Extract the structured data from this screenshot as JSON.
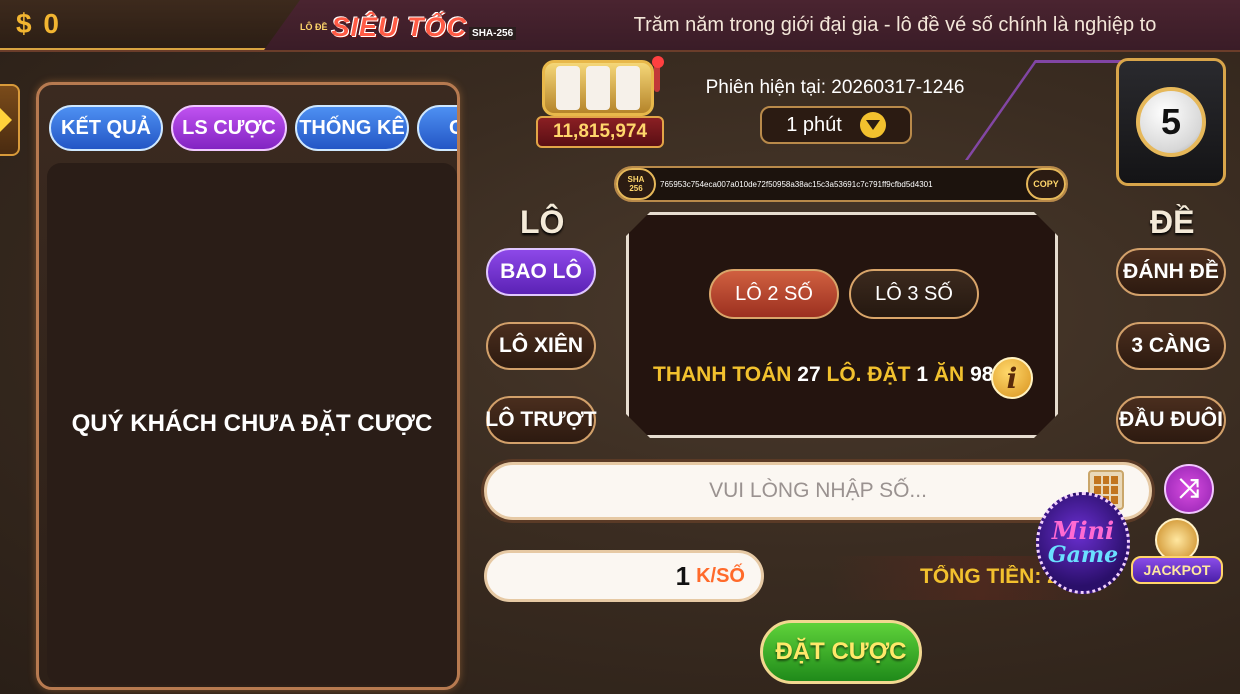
{
  "header": {
    "balance": "$ 0",
    "logo_small": "LÔ ĐỀ",
    "logo_main": "SIÊU TỐC",
    "logo_sub": "SHA-256",
    "slogan": "Trăm năm trong giới đại gia - lô đề vé số chính là nghiệp to"
  },
  "left_panel": {
    "tabs": [
      {
        "label": "KẾT QUẢ"
      },
      {
        "label": "LS CƯỢC"
      },
      {
        "label": "THỐNG KÊ"
      },
      {
        "label": "C"
      }
    ],
    "empty_message": "QUÝ KHÁCH CHƯA ĐẶT CƯỢC"
  },
  "round": {
    "jackpot_amount": "11,815,974",
    "session_label": "Phiên hiện tại: 20260317-1246",
    "timer_value": "1 phút",
    "drawn_ball": "5"
  },
  "hash": {
    "tag_line1": "SHA",
    "tag_line2": "256",
    "value": "765953c754eca007a010de72f50958a38ac15c3a53691c7c791ff9cfbd5d4301",
    "copy_label": "COPY"
  },
  "lo_section": {
    "title": "LÔ",
    "buttons": [
      {
        "label": "BAO LÔ",
        "active": true
      },
      {
        "label": "LÔ XIÊN",
        "active": false
      },
      {
        "label": "LÔ TRƯỢT",
        "active": false
      }
    ]
  },
  "de_section": {
    "title": "ĐỀ",
    "buttons": [
      {
        "label": "ĐÁNH ĐỀ"
      },
      {
        "label": "3 CÀNG"
      },
      {
        "label": "ĐẦU ĐUÔI"
      }
    ]
  },
  "bet_type": {
    "options": [
      {
        "label": "LÔ 2 SỐ",
        "selected": true
      },
      {
        "label": "LÔ 3 SỐ",
        "selected": false
      }
    ],
    "payout_prefix": "THANH TOÁN",
    "payout_pay": "27",
    "payout_mid": "LÔ. ĐẶT",
    "payout_bet": "1",
    "payout_win_label": "ĂN",
    "payout_win": "98"
  },
  "inputs": {
    "number_placeholder": "VUI LÒNG NHẬP SỐ...",
    "amount_value": "1",
    "amount_unit": "K/SỐ",
    "total_label": "TỔNG TIỀN: 2"
  },
  "floating": {
    "minigame_line1": "Mini",
    "minigame_line2": "Game",
    "jackpot_label": "JACKPOT"
  },
  "actions": {
    "bet_label": "ĐẶT CƯỢC"
  }
}
